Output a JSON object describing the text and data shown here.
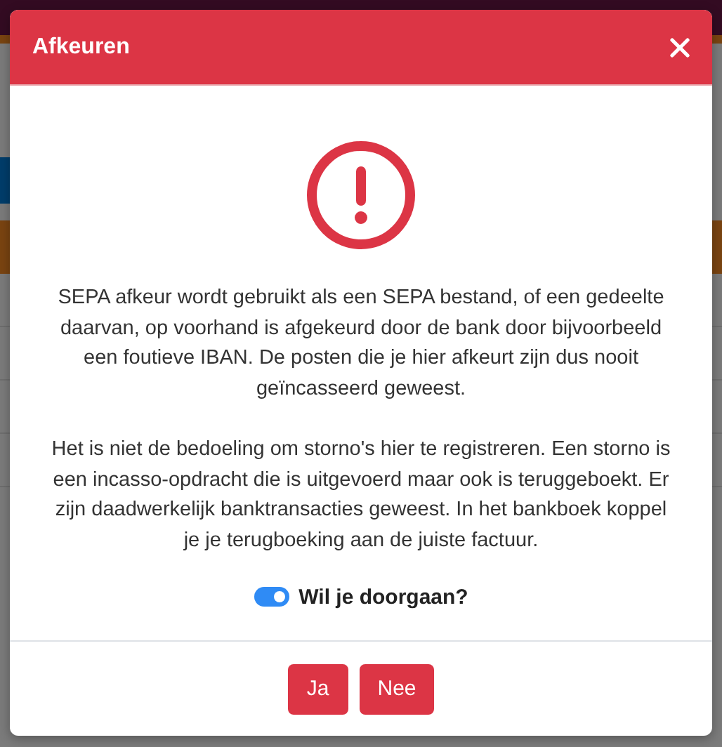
{
  "dialog": {
    "title": "Afkeuren",
    "paragraphs": [
      "SEPA afkeur wordt gebruikt als een SEPA bestand, of een gedeelte daarvan, op voorhand is afgekeurd door de bank door bijvoorbeeld een foutieve IBAN. De posten die je hier afkeurt zijn dus nooit geïncasseerd geweest.",
      "Het is niet de bedoeling om storno's hier te registreren. Een storno is een incasso-opdracht die is uitgevoerd maar ook is teruggeboekt. Er zijn daadwerkelijk banktransacties geweest. In het bankboek koppel je je terugboeking aan de juiste factuur."
    ],
    "confirm": {
      "label": "Wil je doorgaan?",
      "on": true
    },
    "buttons": [
      {
        "label": "Ja"
      },
      {
        "label": "Nee"
      }
    ]
  }
}
